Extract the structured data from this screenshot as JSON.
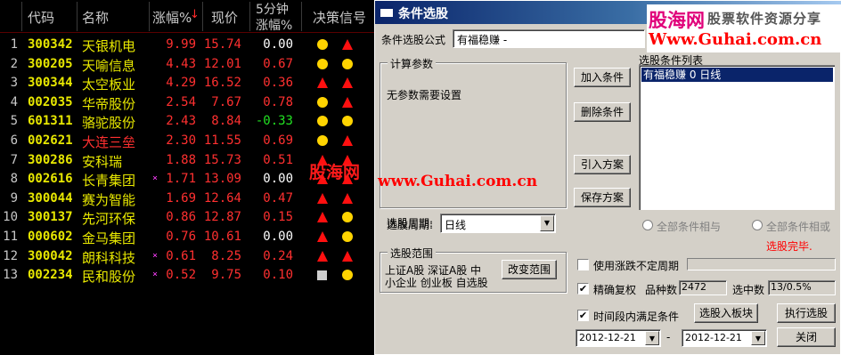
{
  "list": {
    "headers": {
      "code": "代码",
      "name": "名称",
      "pct": "涨幅%",
      "pct_sort": "↓",
      "price": "现价",
      "chg5_top": "5分钟",
      "chg5_bottom": "涨幅%",
      "signal": "决策信号"
    },
    "rows": [
      {
        "idx": "1",
        "code": "300342",
        "name": "天银机电",
        "mark": "",
        "pct": "9.99",
        "price": "15.74",
        "chg": "0.00",
        "name_color": "yellow",
        "chg_color": "white",
        "sig": [
          "dot",
          "tri"
        ]
      },
      {
        "idx": "2",
        "code": "300205",
        "name": "天喻信息",
        "mark": "",
        "pct": "4.43",
        "price": "12.01",
        "chg": "0.67",
        "name_color": "yellow",
        "chg_color": "red",
        "sig": [
          "dot",
          "dot"
        ]
      },
      {
        "idx": "3",
        "code": "300344",
        "name": "太空板业",
        "mark": "",
        "pct": "4.29",
        "price": "16.52",
        "chg": "0.36",
        "name_color": "yellow",
        "chg_color": "red",
        "sig": [
          "tri",
          "tri"
        ]
      },
      {
        "idx": "4",
        "code": "002035",
        "name": "华帝股份",
        "mark": "",
        "pct": "2.54",
        "price": "7.67",
        "chg": "0.78",
        "name_color": "yellow",
        "chg_color": "red",
        "sig": [
          "dot",
          "tri"
        ]
      },
      {
        "idx": "5",
        "code": "601311",
        "name": "骆驼股份",
        "mark": "",
        "pct": "2.43",
        "price": "8.84",
        "chg": "-0.33",
        "name_color": "yellow",
        "chg_color": "green",
        "sig": [
          "dot",
          "dot"
        ]
      },
      {
        "idx": "6",
        "code": "002621",
        "name": "大连三垒",
        "mark": "",
        "pct": "2.30",
        "price": "11.55",
        "chg": "0.69",
        "name_color": "red",
        "chg_color": "red",
        "sig": [
          "dot",
          "tri"
        ]
      },
      {
        "idx": "7",
        "code": "300286",
        "name": "安科瑞",
        "mark": "",
        "pct": "1.88",
        "price": "15.73",
        "chg": "0.51",
        "name_color": "yellow",
        "chg_color": "red",
        "sig": [
          "tri",
          "tri"
        ]
      },
      {
        "idx": "8",
        "code": "002616",
        "name": "长青集团",
        "mark": "×",
        "pct": "1.71",
        "price": "13.09",
        "chg": "0.00",
        "name_color": "yellow",
        "chg_color": "white",
        "sig": [
          "tri",
          "tri"
        ]
      },
      {
        "idx": "9",
        "code": "300044",
        "name": "赛为智能",
        "mark": "",
        "pct": "1.69",
        "price": "12.64",
        "chg": "0.47",
        "name_color": "yellow",
        "chg_color": "red",
        "sig": [
          "tri",
          "tri"
        ]
      },
      {
        "idx": "10",
        "code": "300137",
        "name": "先河环保",
        "mark": "",
        "pct": "0.86",
        "price": "12.87",
        "chg": "0.15",
        "name_color": "yellow",
        "chg_color": "red",
        "sig": [
          "tri",
          "dot"
        ]
      },
      {
        "idx": "11",
        "code": "000602",
        "name": "金马集团",
        "mark": "",
        "pct": "0.76",
        "price": "10.61",
        "chg": "0.00",
        "name_color": "yellow",
        "chg_color": "white",
        "sig": [
          "tri",
          "dot"
        ]
      },
      {
        "idx": "12",
        "code": "300042",
        "name": "朗科科技",
        "mark": "×",
        "pct": "0.61",
        "price": "8.25",
        "chg": "0.24",
        "name_color": "yellow",
        "chg_color": "red",
        "sig": [
          "tri",
          "tri"
        ]
      },
      {
        "idx": "13",
        "code": "002234",
        "name": "民和股份",
        "mark": "×",
        "pct": "0.52",
        "price": "9.75",
        "chg": "0.10",
        "name_color": "yellow",
        "chg_color": "red",
        "sig": [
          "square",
          "dot"
        ]
      }
    ],
    "watermark": "股海网"
  },
  "dialog": {
    "title": "条件选股",
    "formula_label": "条件选股公式",
    "formula_value": "有福稳赚 -",
    "params_group": "计算参数",
    "params_text": "无参数需要设置",
    "add_btn": "加入条件",
    "delete_btn": "删除条件",
    "import_btn": "引入方案",
    "save_btn": "保存方案",
    "cond_list_label": "选股条件列表",
    "cond_list_items": [
      "有福稳赚  0  日线"
    ],
    "period_label": "选股周期:",
    "period_value": "日线",
    "radio_and": "全部条件相与",
    "radio_or": "全部条件相或",
    "status_text": "选股完毕.",
    "scope_group": "选股范围",
    "scope_text_line1": "上证A股 深证A股 中",
    "scope_text_line2": "小企业 创业板 自选股",
    "change_scope_btn": "改变范围",
    "use_period_label": "使用涨跌不定周期",
    "precise_label": "精确复权",
    "count_label": "品种数",
    "count_value": "2472",
    "selected_label": "选中数",
    "selected_value": "13/0.5%",
    "time_label": "时间段内满足条件",
    "to_board_btn": "选股入板块",
    "run_btn": "执行选股",
    "date_from": "2012-12-21",
    "date_sep": "-",
    "date_to": "2012-12-21",
    "close_btn": "关闭",
    "checked_mark": "✔"
  },
  "brand": {
    "name": "股海网",
    "slogan": "股票软件资源分享",
    "url": "Www.Guhai.com.cn"
  },
  "watermark_url": "www.Guhai.com.cn",
  "colors": {
    "rise": "#ff3030",
    "fall": "#22e022",
    "code": "#e8e800",
    "selection": "#0a246a"
  }
}
